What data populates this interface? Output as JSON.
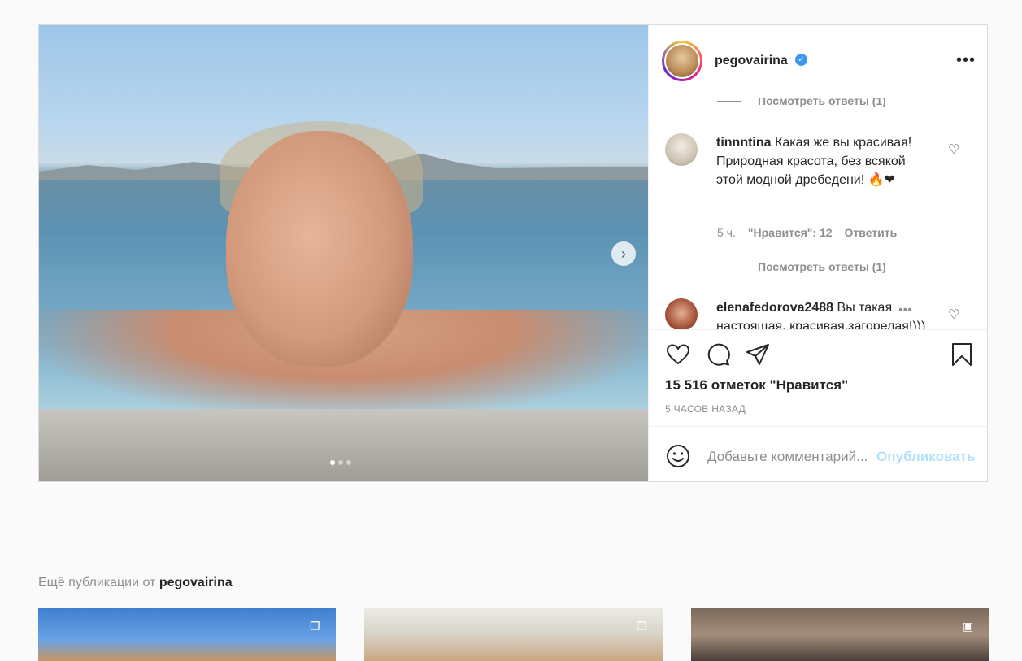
{
  "post": {
    "username": "pegovairina",
    "verified": true,
    "carousel": {
      "slides": 3,
      "active": 0
    },
    "likes": "15 516 отметок \"Нравится\"",
    "time": "5 ЧАСОВ НАЗАД"
  },
  "comments": {
    "replies_top": "Посмотреть ответы (1)",
    "items": [
      {
        "user": "tinnntina",
        "text": "Какая же вы красивая! Природная красота, без всякой этой модной дребедени! 🔥❤",
        "age": "5 ч.",
        "likes": "\"Нравится\": 12",
        "reply": "Ответить",
        "replies": "Посмотреть ответы (1)"
      },
      {
        "user": "elenafedorova2488",
        "text": "Вы такая настоящая, красивая,загорелая!))) Просто"
      }
    ]
  },
  "add_comment": {
    "placeholder": "Добавьте комментарий...",
    "publish": "Опубликовать"
  },
  "more_from": {
    "prefix": "Ещё публикации от",
    "username": "pegovairina"
  },
  "colors": {
    "accent": "#3897f0",
    "publish_disabled": "#b2dffc",
    "muted": "#8e8e8e"
  }
}
